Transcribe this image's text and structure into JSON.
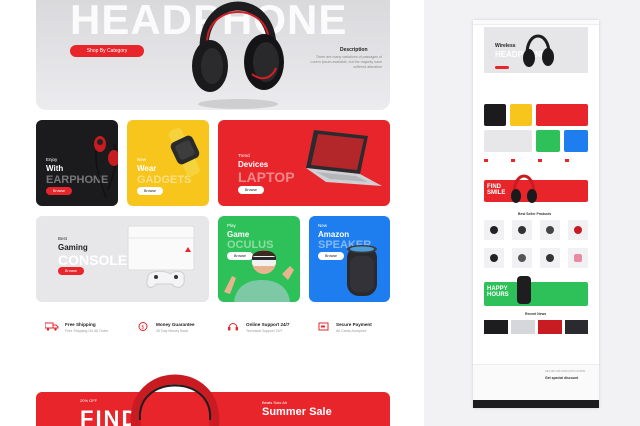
{
  "hero": {
    "word": "HEADPHONE",
    "button": "Shop By Category",
    "desc_title": "Description",
    "desc_text": "There are many variations of passages of Lorem Ipsum available, but the majority have suffered alteration"
  },
  "cards": [
    {
      "small": "Enjoy",
      "title": "With",
      "big": "EARPHONE",
      "button": "Browse",
      "color": "#1b1b1d"
    },
    {
      "small": "New",
      "title": "Wear",
      "big": "GADGETS",
      "button": "Browse",
      "color": "#f7c51c"
    },
    {
      "small": "Trend",
      "title": "Devices",
      "big": "LAPTOP",
      "button": "Browse",
      "color": "#e8252b"
    },
    {
      "small": "Best",
      "title": "Gaming",
      "big": "CONSOLE",
      "button": "Browse",
      "color": "#e7e7ea"
    },
    {
      "small": "Play",
      "title": "Game",
      "big": "OCULUS",
      "button": "Browse",
      "color": "#2fc159"
    },
    {
      "small": "New",
      "title": "Amazon",
      "big": "SPEAKER",
      "button": "Browse",
      "color": "#1e7ef0"
    }
  ],
  "features": [
    {
      "title": "Free Shipping",
      "sub": "Free Shipping On All Order",
      "icon": "truck-icon"
    },
    {
      "title": "Money Guarantee",
      "sub": "30 Day Money Back",
      "icon": "money-guarantee-icon"
    },
    {
      "title": "Online Support 24/7",
      "sub": "Technical Support 24/7",
      "icon": "headset-icon"
    },
    {
      "title": "Secure Payment",
      "sub": "All Cards Accepted",
      "icon": "lock-icon"
    }
  ],
  "banner": {
    "small": "20% OFF",
    "find": "FIND",
    "sub": "Beats Solo Air",
    "title": "Summer Sale"
  },
  "preview": {
    "hero_title": "Wireless",
    "hero_word": "HEADPHONE",
    "sale_word": "FIND SMILE",
    "best_sellers": "Best Seller Products",
    "happy_word": "HAPPY HOURS",
    "recent_news": "Recent News",
    "footer_title": "Get special discount",
    "footer_sub": "GET 20% OFF DISCOUNT COUPON"
  },
  "colors": {
    "accent": "#e8252b",
    "yellow": "#f7c51c",
    "green": "#2fc159",
    "blue": "#1e7ef0"
  }
}
